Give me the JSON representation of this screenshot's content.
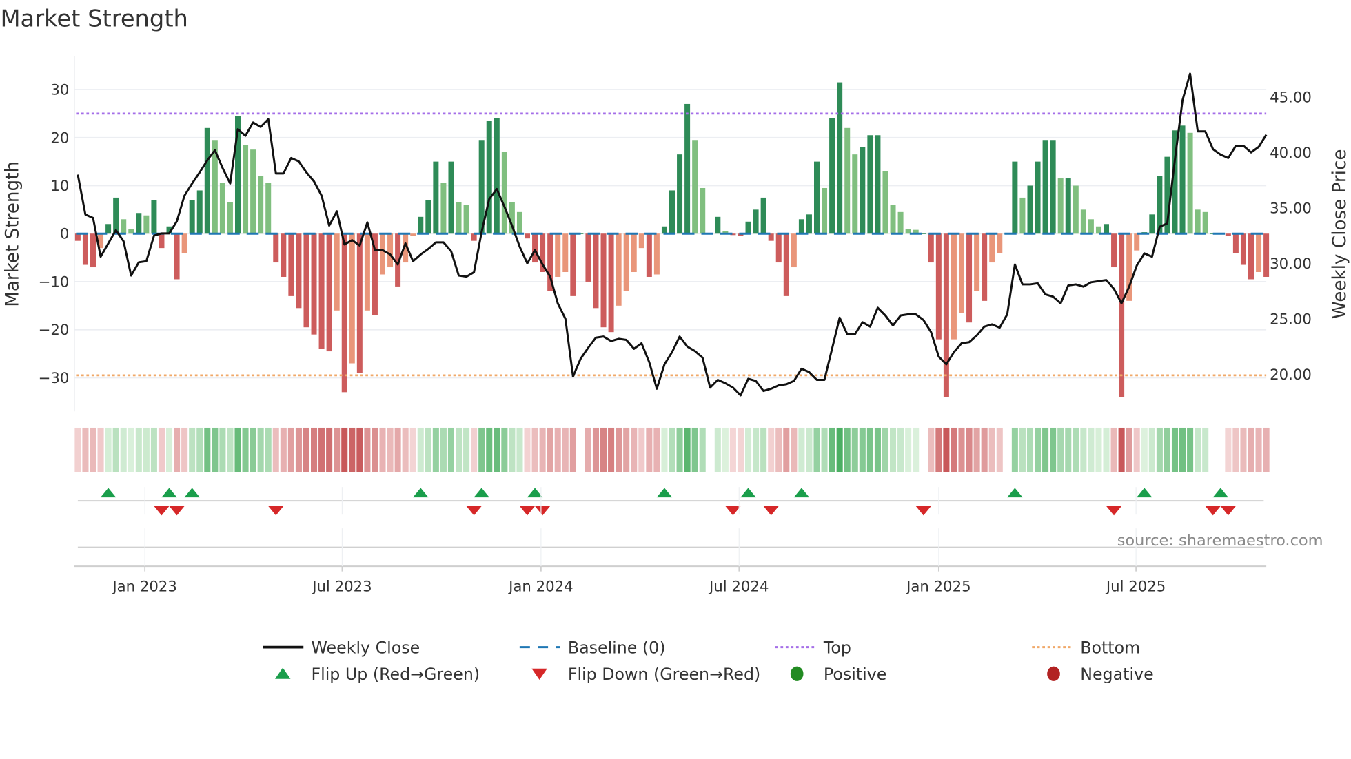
{
  "chart_data": {
    "type": "bar",
    "title": "Market Strength",
    "ylabel_left": "Market Strength",
    "ylabel_right": "Weekly Close Price",
    "ylim_left": [
      -37,
      37
    ],
    "ylim_right": [
      16.66,
      48.7
    ],
    "yticks_left": [
      {
        "v": 30,
        "label": "30"
      },
      {
        "v": 20,
        "label": "20"
      },
      {
        "v": 10,
        "label": "10"
      },
      {
        "v": 0,
        "label": "0"
      },
      {
        "v": -10,
        "label": "−10"
      },
      {
        "v": -20,
        "label": "−20"
      },
      {
        "v": -30,
        "label": "−30"
      }
    ],
    "yticks_right": [
      {
        "v": 45,
        "label": "45.00"
      },
      {
        "v": 40,
        "label": "40.00"
      },
      {
        "v": 35,
        "label": "35.00"
      },
      {
        "v": 30,
        "label": "30.00"
      },
      {
        "v": 25,
        "label": "25.00"
      },
      {
        "v": 20,
        "label": "20.00"
      }
    ],
    "xticks": [
      {
        "week": 8.8,
        "label": "Jan 2023"
      },
      {
        "week": 34.7,
        "label": "Jul 2023"
      },
      {
        "week": 60.8,
        "label": "Jan 2024"
      },
      {
        "week": 86.8,
        "label": "Jul 2024"
      },
      {
        "week": 113,
        "label": "Jan 2025"
      },
      {
        "week": 138.9,
        "label": "Jul 2025"
      }
    ],
    "top_level": 25,
    "bottom_level": -29.5,
    "baseline": 0,
    "strength": [
      -1.5,
      -6.5,
      -7,
      -3,
      2,
      7.5,
      3,
      1,
      4.3,
      3.8,
      7,
      -3,
      1.5,
      -9.5,
      -4,
      7,
      9,
      22,
      19.5,
      10.5,
      6.5,
      24.5,
      18.5,
      17.5,
      12,
      10.5,
      -6,
      -9,
      -13,
      -15.5,
      -19.5,
      -21,
      -24,
      -24.5,
      -16,
      -33,
      -27,
      -29,
      -16,
      -17,
      -8.5,
      -7,
      -11,
      -6,
      -0.5,
      3.5,
      7,
      15,
      10.5,
      15,
      6.5,
      6,
      -1.5,
      19.5,
      23.5,
      24,
      17,
      6.5,
      4.5,
      -1,
      -6,
      -8,
      -12,
      -9,
      -8,
      -13,
      0,
      -10,
      -15.5,
      -19.5,
      -20.5,
      -15,
      -12,
      -8,
      -3,
      -9,
      -8.5,
      1.5,
      9,
      16.5,
      27,
      19.5,
      9.5,
      0,
      3.5,
      0.5,
      -0.3,
      -0.5,
      2.5,
      5,
      7.5,
      -1.5,
      -6,
      -13,
      -7,
      3,
      4,
      15,
      9.5,
      24,
      31.5,
      22,
      16.5,
      18,
      20.5,
      20.5,
      13,
      6,
      4.5,
      1,
      0.8,
      0,
      -6,
      -22,
      -34,
      -22,
      -16.5,
      -18.5,
      -12,
      -14,
      -6,
      -4,
      0,
      15,
      7.5,
      10,
      15,
      19.5,
      19.5,
      11.5,
      11.5,
      10,
      5,
      3,
      1.5,
      2,
      -7,
      -34,
      -14,
      -3.5,
      0.3,
      4,
      12,
      16,
      21.5,
      22.5,
      21,
      5,
      4.5,
      0,
      0,
      -0.5,
      -4,
      -6.5,
      -9.5,
      -8,
      -9
    ],
    "weekly_close": [
      38.0,
      34.4,
      34.1,
      30.6,
      31.8,
      33.0,
      32.0,
      28.9,
      30.1,
      30.2,
      32.5,
      32.7,
      32.7,
      33.8,
      36.1,
      37.2,
      38.2,
      39.3,
      40.2,
      38.6,
      37.2,
      42.1,
      41.5,
      42.7,
      42.3,
      43.0,
      38.1,
      38.1,
      39.5,
      39.2,
      38.2,
      37.4,
      36.1,
      33.4,
      34.7,
      31.7,
      32.1,
      31.6,
      33.7,
      31.2,
      31.2,
      30.8,
      29.9,
      31.8,
      30.2,
      30.8,
      31.3,
      31.9,
      31.9,
      31.1,
      28.9,
      28.8,
      29.2,
      32.8,
      35.8,
      36.7,
      35.1,
      33.4,
      31.5,
      30.0,
      31.2,
      29.9,
      28.8,
      26.4,
      25.0,
      19.8,
      21.4,
      22.4,
      23.3,
      23.4,
      23.0,
      23.2,
      23.1,
      22.3,
      22.8,
      21.1,
      18.7,
      20.9,
      22.0,
      23.4,
      22.5,
      22.1,
      21.5,
      18.8,
      19.5,
      19.2,
      18.8,
      18.1,
      19.6,
      19.4,
      18.5,
      18.7,
      19.0,
      19.1,
      19.4,
      20.5,
      20.2,
      19.5,
      19.5,
      22.3,
      25.1,
      23.6,
      23.6,
      24.7,
      24.3,
      26.0,
      25.3,
      24.4,
      25.3,
      25.4,
      25.4,
      24.9,
      23.8,
      21.6,
      20.9,
      22.0,
      22.8,
      22.9,
      23.5,
      24.3,
      24.5,
      24.2,
      25.4,
      29.9,
      28.1,
      28.1,
      28.2,
      27.2,
      27.0,
      26.4,
      28.0,
      28.1,
      27.9,
      28.3,
      28.4,
      28.5,
      27.7,
      26.4,
      27.9,
      29.8,
      30.9,
      30.6,
      33.3,
      33.6,
      39.3,
      44.7,
      47.1,
      41.9,
      41.9,
      40.3,
      39.8,
      39.5,
      40.6,
      40.6,
      40.0,
      40.5,
      41.6
    ],
    "flip_up_weeks": [
      4,
      12,
      15,
      45,
      53,
      60,
      77,
      88,
      95,
      123,
      140,
      150
    ],
    "flip_down_weeks": [
      11,
      13,
      26,
      52,
      59,
      61,
      86,
      91,
      111,
      136,
      149,
      151
    ],
    "source": "source: sharemaestro.com",
    "legend": [
      {
        "label": "Weekly Close",
        "kind": "line",
        "color": "#111111"
      },
      {
        "label": "Baseline (0)",
        "kind": "dash",
        "color": "#1f77b4"
      },
      {
        "label": "Top",
        "kind": "dot",
        "color": "#a46ee8"
      },
      {
        "label": "Bottom",
        "kind": "dot",
        "color": "#f0a868"
      },
      {
        "label": "Flip Up (Red→Green)",
        "kind": "up",
        "color": "#1a9e4b"
      },
      {
        "label": "Flip Down (Green→Red)",
        "kind": "down",
        "color": "#d62728"
      },
      {
        "label": "Positive",
        "kind": "circle",
        "color": "#228b22"
      },
      {
        "label": "Negative",
        "kind": "circle",
        "color": "#b22222"
      }
    ],
    "colors": {
      "pos_strong": "#2e8b57",
      "pos_weak": "#80bf7f",
      "neg_strong": "#cd5c5c",
      "neg_weak": "#e9967a",
      "grid": "#eceef2"
    }
  }
}
